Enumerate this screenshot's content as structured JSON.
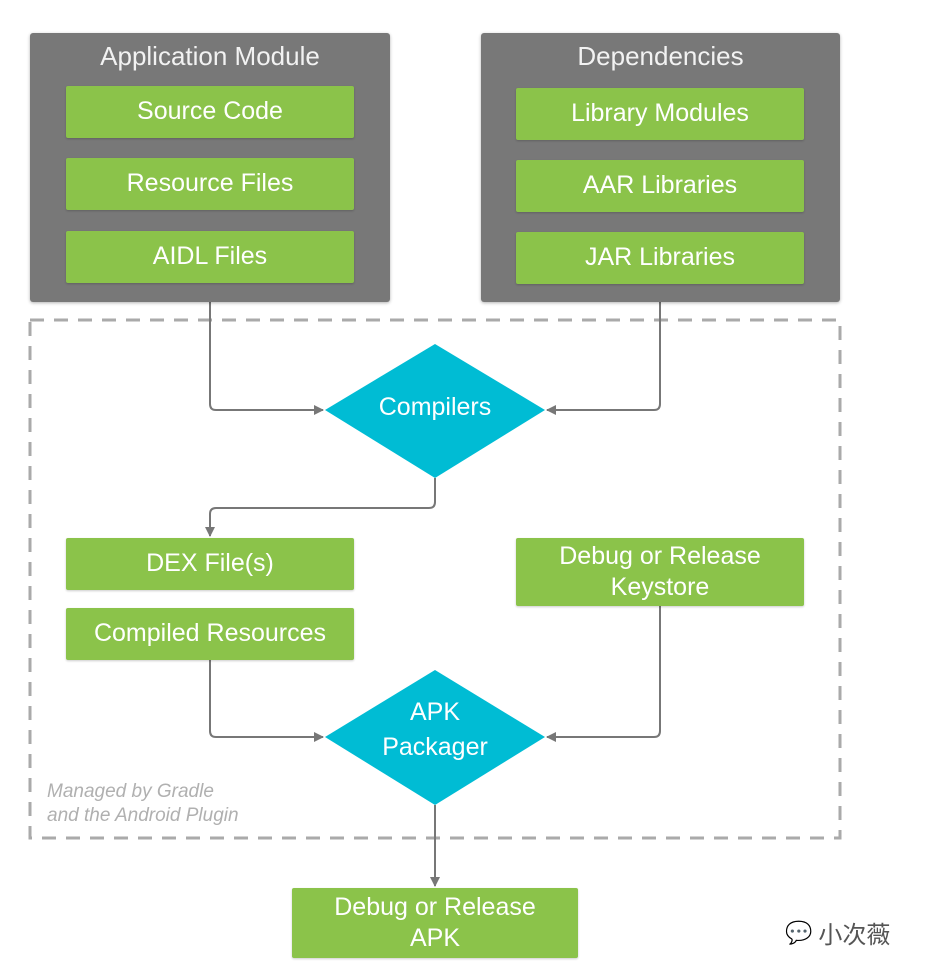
{
  "colors": {
    "panel": "#787878",
    "green": "#8bc34a",
    "cyan": "#00bcd4",
    "line": "#777777",
    "dashed": "#aaaaaa"
  },
  "app_module": {
    "title": "Application Module",
    "items": [
      "Source Code",
      "Resource Files",
      "AIDL Files"
    ]
  },
  "dependencies": {
    "title": "Dependencies",
    "items": [
      "Library Modules",
      "AAR Libraries",
      "JAR Libraries"
    ]
  },
  "compilers": "Compilers",
  "dex": "DEX File(s)",
  "compiled_resources": "Compiled Resources",
  "keystore": {
    "line1": "Debug or Release",
    "line2": "Keystore"
  },
  "packager": {
    "line1": "APK",
    "line2": "Packager"
  },
  "output": {
    "line1": "Debug or Release",
    "line2": "APK"
  },
  "managed_note": {
    "line1": "Managed by Gradle",
    "line2": "and the Android Plugin"
  },
  "watermark": "小次薇"
}
